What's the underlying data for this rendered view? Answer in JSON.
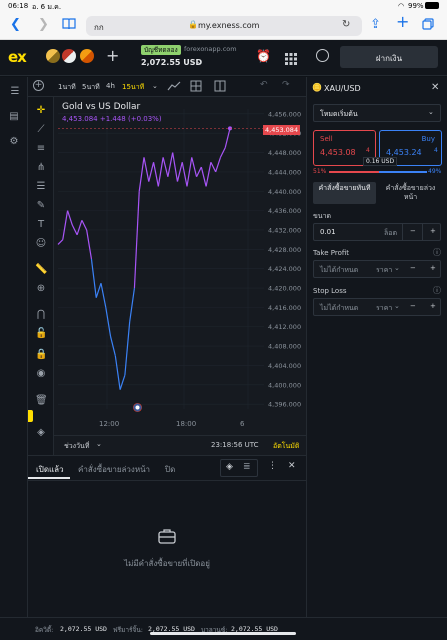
{
  "status": {
    "time": "06:18",
    "date": "อ. 6 ม.ค.",
    "battery": "99%"
  },
  "browser": {
    "tab_label": "กก",
    "url": "my.exness.com"
  },
  "header": {
    "logo": "ex",
    "account_type": "บัญชีทดลอง",
    "account_server": "forexonapp.com",
    "balance": "2,072.55 USD",
    "deposit_label": "ฝากเงิน"
  },
  "toolbar": {
    "tf1": "1นาที",
    "tf2": "5นาที",
    "tf3": "4h",
    "tf4": "15นาที"
  },
  "chart": {
    "title": "Gold vs US Dollar",
    "ohlc": "4,453.084 +1.448 (+0.03%)",
    "last_price": "4,453.084",
    "time_range_label": "ช่วงวันที่",
    "clock": "23:18:56 UTC",
    "auto_label": "อัตโนมัติ"
  },
  "chart_data": {
    "type": "line",
    "title": "Gold vs US Dollar",
    "y_ticks": [
      "4,456.000",
      "4,452.000",
      "4,448.000",
      "4,444.000",
      "4,440.000",
      "4,436.000",
      "4,432.000",
      "4,428.000",
      "4,424.000",
      "4,420.000",
      "4,416.000",
      "4,412.000",
      "4,408.000",
      "4,404.000",
      "4,400.000",
      "4,396.000"
    ],
    "x_ticks": [
      "12:00",
      "18:00",
      "6"
    ],
    "ylim": [
      4395,
      4457
    ],
    "series": [
      {
        "values": [
          4429,
          4430,
          4436,
          4433,
          4431,
          4434,
          4432,
          4426,
          4418,
          4421,
          4416,
          4410,
          4406,
          4399,
          4402,
          4413,
          4420,
          4440,
          4447,
          4442,
          4446,
          4441,
          4447,
          4443,
          4448,
          4442,
          4446,
          4441,
          4447,
          4443,
          4445,
          4441,
          4446,
          4444,
          4447,
          4449,
          4453
        ]
      }
    ]
  },
  "panel": {
    "symbol": "XAU/USD",
    "mode": "โหมดเริ่มต้น",
    "sell_label": "Sell",
    "sell_price": "4,453.08",
    "sell_sup": "4",
    "buy_label": "Buy",
    "buy_price": "4,453.24",
    "buy_sup": "4",
    "spread": "0.16 USD",
    "sell_pct": "51%",
    "buy_pct": "49%",
    "tab_market": "คำสั่งซื้อขายทันที",
    "tab_pending": "คำสั่งซื้อขายล่วงหน้า",
    "size_label": "ขนาด",
    "size_value": "0.01",
    "size_unit": "ล็อต",
    "tp_label": "Take Profit",
    "tp_placeholder": "ไม่ได้กำหนด",
    "tp_unit": "ราคา",
    "sl_label": "Stop Loss",
    "sl_placeholder": "ไม่ได้กำหนด",
    "sl_unit": "ราคา"
  },
  "bottom": {
    "tab_open": "เปิดแล้ว",
    "tab_pending": "คำสั่งซื้อขายล่วงหน้า",
    "tab_closed": "ปิด",
    "empty": "ไม่มีคำสั่งซื้อขายที่เปิดอยู่"
  },
  "footer": {
    "equity_label": "อิควิตี้:",
    "equity": "2,072.55 USD",
    "margin_label": "ฟรีมาร์จิ้น:",
    "margin": "2,072.55 USD",
    "balance_label": "บาลานซ์:",
    "balance": "2,072.55 USD"
  },
  "colors": {
    "sell": "#e5484d",
    "buy": "#3b82f6",
    "accent": "#ffde02",
    "line_up": "#a855f7",
    "line_down": "#3b82f6"
  }
}
